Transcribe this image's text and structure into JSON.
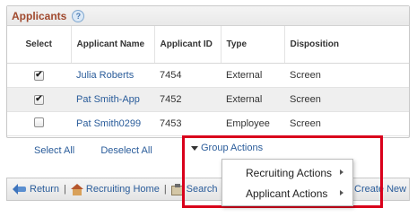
{
  "panel": {
    "title": "Applicants",
    "help_icon": "?"
  },
  "table": {
    "columns": [
      "Select",
      "Applicant Name",
      "Applicant ID",
      "Type",
      "Disposition"
    ],
    "rows": [
      {
        "checked": "✔",
        "name": "Julia Roberts",
        "id": "7454",
        "type": "External",
        "disposition": "Screen"
      },
      {
        "checked": "✔",
        "name": "Pat Smith-App",
        "id": "7452",
        "type": "External",
        "disposition": "Screen"
      },
      {
        "checked": "",
        "name": "Pat Smith0299",
        "id": "7453",
        "type": "Employee",
        "disposition": "Screen"
      }
    ]
  },
  "links": {
    "select_all": "Select All",
    "deselect_all": "Deselect All",
    "group_actions": "Group Actions"
  },
  "menu": {
    "items": [
      {
        "label": "Recruiting Actions"
      },
      {
        "label": "Applicant Actions"
      }
    ]
  },
  "footer": {
    "return": "Return",
    "recruiting_home": "Recruiting Home",
    "search": "Search",
    "create_new": "Create New"
  },
  "colors": {
    "title": "#a0492e",
    "link": "#2a5c9a",
    "highlight_border": "#d9001b"
  }
}
